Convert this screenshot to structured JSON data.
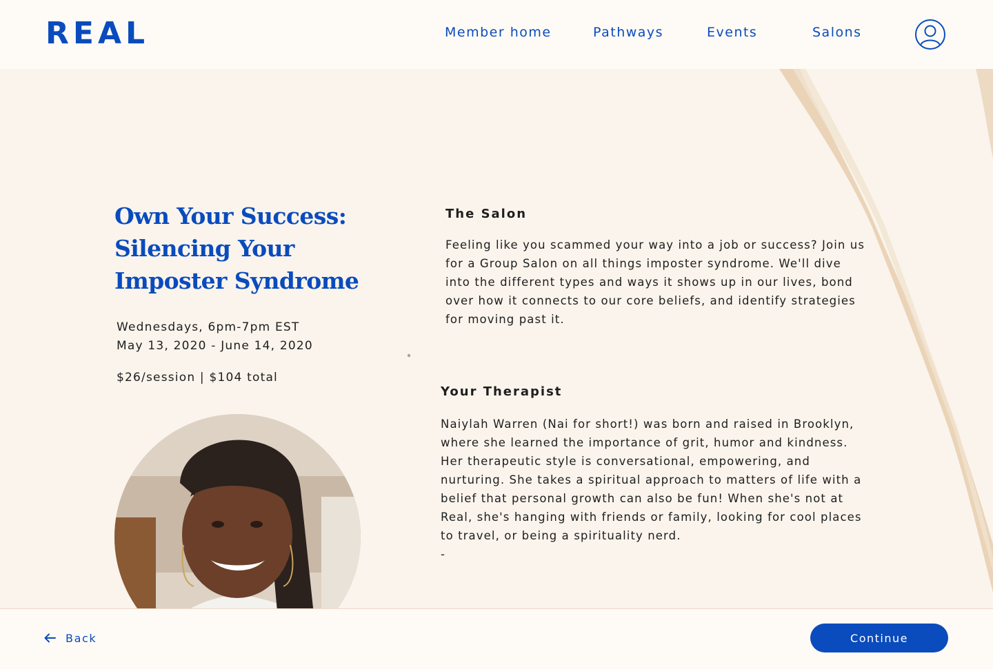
{
  "header": {
    "logo_text": "REAL",
    "nav": {
      "member_home": "Member home",
      "pathways": "Pathways",
      "events": "Events",
      "salons": "Salons"
    },
    "account_icon": "user-circle-icon"
  },
  "salon": {
    "title_lines": [
      "Own Your Success:",
      "Silencing Your",
      "Imposter Syndrome"
    ],
    "schedule_lines": [
      "Wednesdays, 6pm-7pm EST",
      "May 13, 2020 - June 14, 2020"
    ],
    "price": "$26/session | $104 total",
    "description_heading": "The Salon",
    "description_lines": [
      "Feeling like you scammed your way into a job or success? Join us",
      "for a Group Salon on all things imposter syndrome. We'll dive",
      "into the different types and ways it shows up in our lives, bond",
      "over how it connects to our core beliefs, and identify strategies",
      "for moving past it."
    ]
  },
  "therapist": {
    "heading": "Your Therapist",
    "bio_lines": [
      "Naiylah Warren (Nai for short!) was born and raised in Brooklyn,",
      "where she learned the importance of grit, humor and kindness.",
      "Her therapeutic style is conversational, empowering, and",
      "nurturing. She takes a spiritual approach to matters of life with a",
      "belief that personal growth can also be fun! When she's not at",
      "Real, she's hanging with friends or family, looking for cool places",
      "to travel, or being a spirituality nerd.",
      "-"
    ]
  },
  "footer": {
    "back_label": "Back",
    "back_icon": "arrow-left-icon",
    "continue_label": "Continue"
  },
  "colors": {
    "brand_blue": "#0a4bbd",
    "background": "#faf4ec",
    "header_bg": "#fefbf6",
    "text": "#1e1e1e"
  }
}
